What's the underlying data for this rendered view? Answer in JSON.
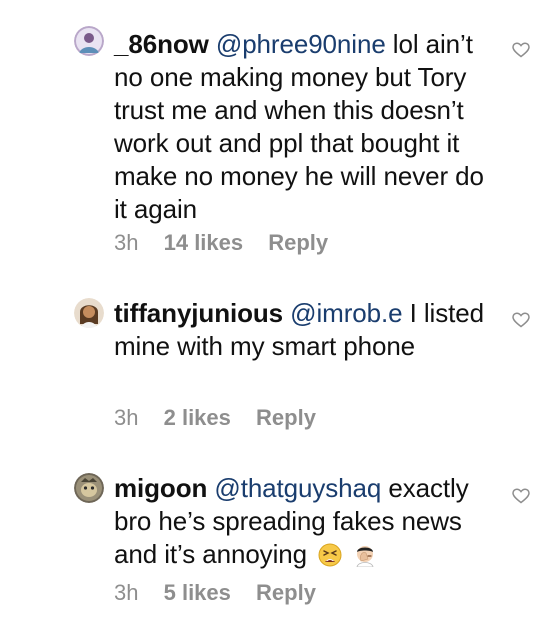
{
  "comments": [
    {
      "username": "_86now",
      "mention": "@phree90nine",
      "text": " lol ain’t no one making money but Tory trust me and when this doesn’t work out and ppl that bought it make no money he will never do it again",
      "time": "3h",
      "likes": "14 likes",
      "reply": "Reply",
      "emojis": []
    },
    {
      "username": "tiffanyjunious",
      "mention": "@imrob.e",
      "text": " I listed mine with my smart phone",
      "time": "3h",
      "likes": "2 likes",
      "reply": "Reply",
      "emojis": []
    },
    {
      "username": "migoon",
      "mention": "@thatguyshaq",
      "text": " exactly bro he’s spreading fakes news and it’s annoying",
      "time": "3h",
      "likes": "5 likes",
      "reply": "Reply",
      "emojis": [
        "tired-face-emoji",
        "man-facepalming-emoji"
      ]
    }
  ],
  "colors": {
    "text": "#111111",
    "mention": "#1a3d6e",
    "meta": "#8e8e8e"
  }
}
